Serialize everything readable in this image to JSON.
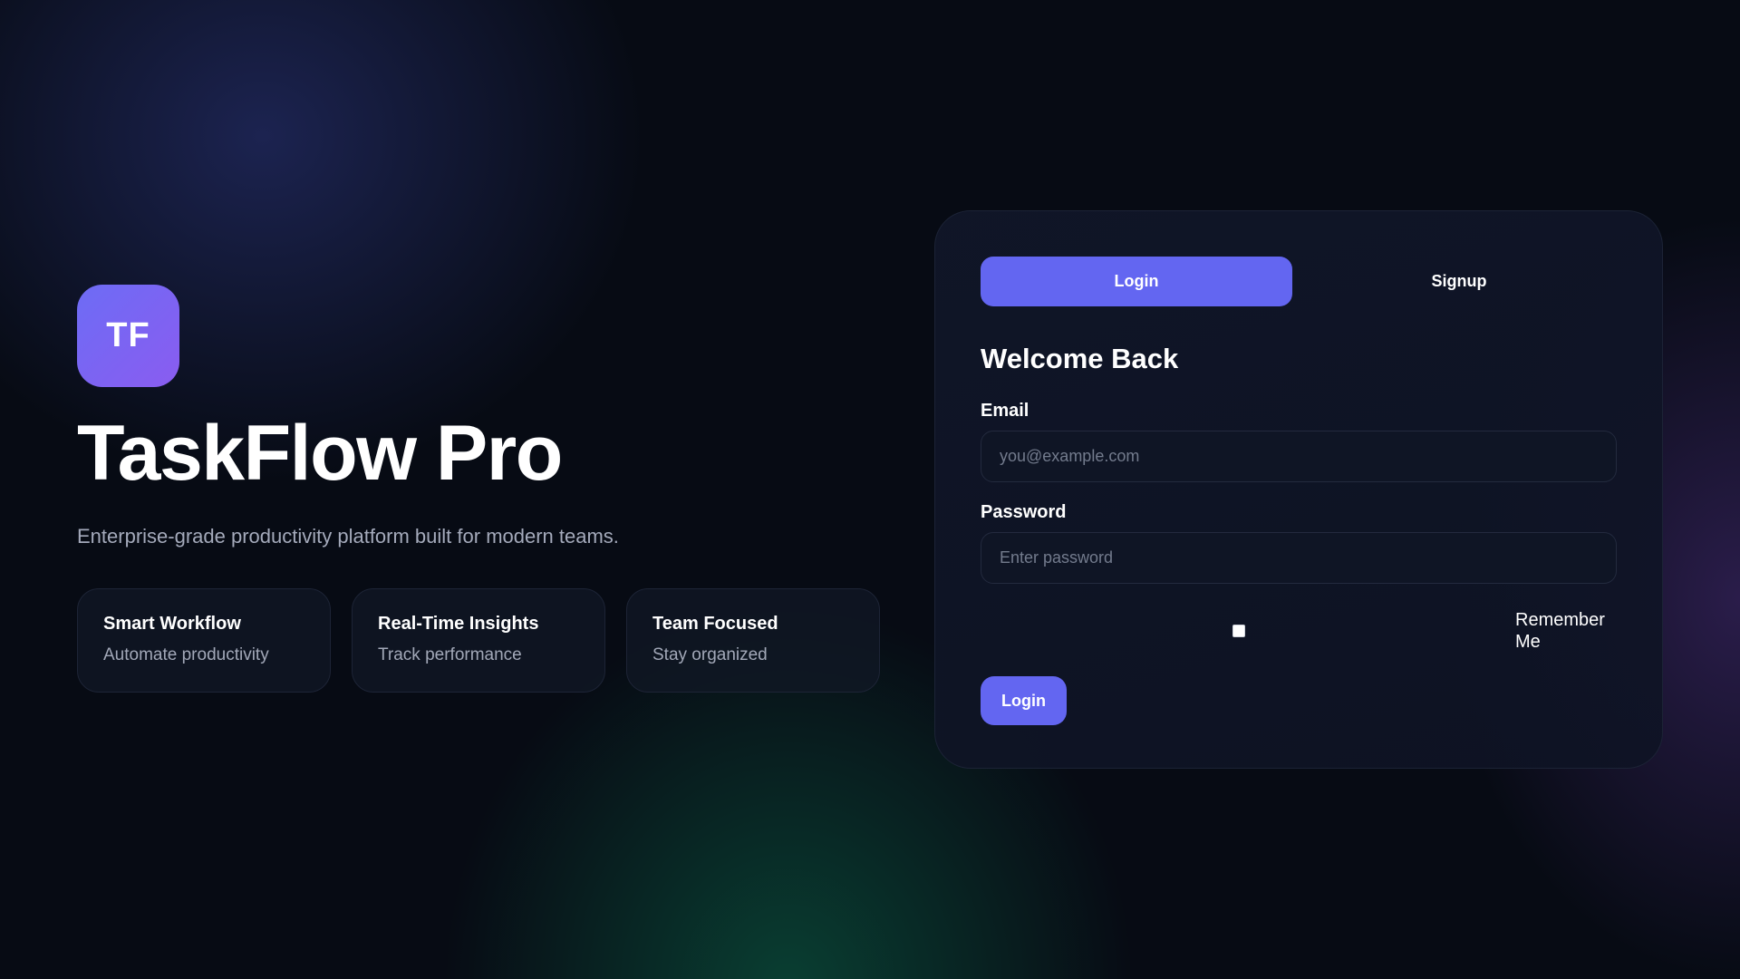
{
  "brand": {
    "logo_text": "TF",
    "title": "TaskFlow Pro",
    "subtitle": "Enterprise-grade productivity platform built for modern teams."
  },
  "features": [
    {
      "title": "Smart Workflow",
      "subtitle": "Automate productivity"
    },
    {
      "title": "Real-Time Insights",
      "subtitle": "Track performance"
    },
    {
      "title": "Team Focused",
      "subtitle": "Stay organized"
    }
  ],
  "auth": {
    "tabs": [
      {
        "label": "Login",
        "active": true
      },
      {
        "label": "Signup",
        "active": false
      }
    ],
    "heading": "Welcome Back",
    "email": {
      "label": "Email",
      "placeholder": "you@example.com",
      "value": ""
    },
    "password": {
      "label": "Password",
      "placeholder": "Enter password",
      "value": ""
    },
    "remember": {
      "label": "Remember Me",
      "checked": false
    },
    "submit_label": "Login"
  },
  "colors": {
    "accent": "#6366f1",
    "background": "#070b14",
    "logo_gradient_start": "#6d6cf5",
    "logo_gradient_end": "#8a5cf0"
  }
}
